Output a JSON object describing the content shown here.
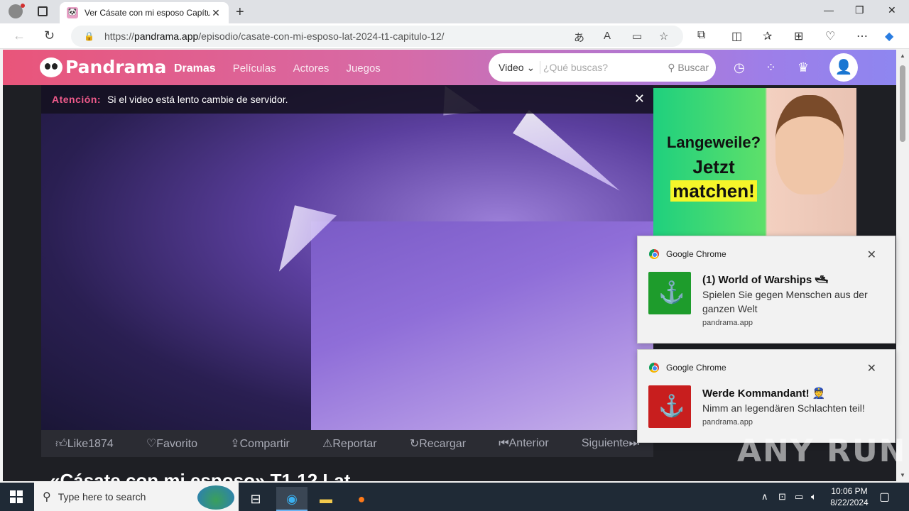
{
  "browser": {
    "tab_title": "Ver Cásate con mi esposo Capítul",
    "url_prefix": "https://",
    "url_host": "pandrama.app",
    "url_path": "/episodio/casate-con-mi-esposo-lat-2024-t1-capitulo-12/"
  },
  "site": {
    "logo": "Pandrama",
    "nav": [
      "Dramas",
      "Películas",
      "Actores",
      "Juegos"
    ],
    "search_select": "Video",
    "search_placeholder": "¿Qué buscas?",
    "search_button": "Buscar"
  },
  "player": {
    "alert_label": "Atención:",
    "alert_text": "Si el video está lento cambie de servidor.",
    "actions": [
      "Like1874",
      "Favorito",
      "Compartir",
      "Reportar",
      "Recargar",
      "Anterior",
      "Siguiente"
    ]
  },
  "page_title": "«Cásate con mi esposo» T1 12 Lat",
  "ad": {
    "line1": "Langeweile?",
    "line2": "Jetzt",
    "line3": "matchen!"
  },
  "notifications": [
    {
      "app": "Google Chrome",
      "title": "(1) World of Warships 🛥",
      "message": "Spielen Sie gegen Menschen aus der ganzen Welt",
      "source": "pandrama.app",
      "color": "#1e9c2c"
    },
    {
      "app": "Google Chrome",
      "title": "Werde Kommandant! 👮",
      "message": "Nimm an legendären Schlachten teil!",
      "source": "pandrama.app",
      "color": "#c81e1e"
    }
  ],
  "watermark": "ANY RUN",
  "taskbar": {
    "search_placeholder": "Type here to search",
    "time": "10:06 PM",
    "date": "8/22/2024"
  }
}
